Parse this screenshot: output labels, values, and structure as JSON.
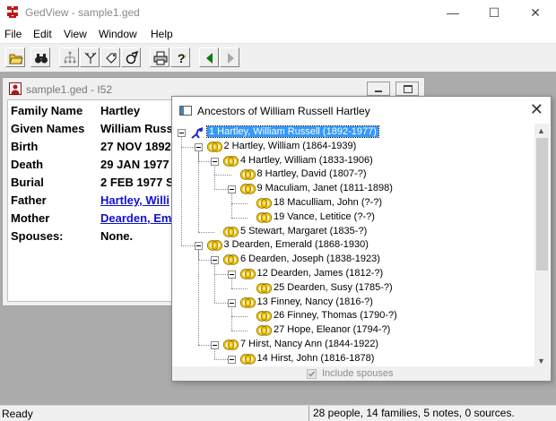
{
  "app": {
    "title": "GedView - sample1.ged",
    "minimize": "—",
    "maximize": "☐",
    "close": "✕"
  },
  "menu": [
    "File",
    "Edit",
    "View",
    "Window",
    "Help"
  ],
  "toolbar": {
    "buttons": [
      "open-folder",
      "binoculars-find",
      "family-tree",
      "descendant-tree",
      "tag",
      "gear-check",
      "print",
      "help-question",
      "back-arrow",
      "forward-arrow"
    ]
  },
  "individual": {
    "title": "sample1.ged - I52",
    "rows": [
      {
        "label": "Family Name",
        "value": "Hartley",
        "link": false
      },
      {
        "label": "Given Names",
        "value": "William Russ",
        "link": false
      },
      {
        "label": "Birth",
        "value": "27 NOV 1892",
        "link": false
      },
      {
        "label": "Death",
        "value": "29 JAN 1977 I",
        "link": false
      },
      {
        "label": "Burial",
        "value": "2 FEB 1977  S",
        "link": false
      },
      {
        "label": "Father",
        "value": "Hartley, Willi",
        "link": true
      },
      {
        "label": "Mother",
        "value": "Dearden, Em",
        "link": true
      },
      {
        "label": "Spouses:",
        "value": "None.",
        "link": false
      }
    ]
  },
  "ancestors": {
    "title": "Ancestors of William Russell Hartley",
    "close": "✕",
    "nodes": [
      {
        "text": "1  Hartley, William Russell (1892-1977)",
        "depth": 0,
        "expanded": true,
        "selected": true,
        "root": true
      },
      {
        "text": "2  Hartley, William (1864-1939)",
        "depth": 1,
        "expanded": true
      },
      {
        "text": "4  Hartley, William (1833-1906)",
        "depth": 2,
        "expanded": true
      },
      {
        "text": "8  Hartley, David (1807-?)",
        "depth": 3,
        "expanded": false
      },
      {
        "text": "9  Maculiam, Janet (1811-1898)",
        "depth": 3,
        "expanded": true
      },
      {
        "text": "18  Maculliam, John (?-?)",
        "depth": 4,
        "expanded": false
      },
      {
        "text": "19  Vance, Letitice (?-?)",
        "depth": 4,
        "expanded": false
      },
      {
        "text": "5  Stewart, Margaret (1835-?)",
        "depth": 2,
        "expanded": false
      },
      {
        "text": "3  Dearden, Emerald (1868-1930)",
        "depth": 1,
        "expanded": true
      },
      {
        "text": "6  Dearden, Joseph (1838-1923)",
        "depth": 2,
        "expanded": true
      },
      {
        "text": "12  Dearden, James (1812-?)",
        "depth": 3,
        "expanded": true
      },
      {
        "text": "25  Dearden, Susy (1785-?)",
        "depth": 4,
        "expanded": false
      },
      {
        "text": "13  Finney, Nancy (1816-?)",
        "depth": 3,
        "expanded": true
      },
      {
        "text": "26  Finney, Thomas (1790-?)",
        "depth": 4,
        "expanded": false
      },
      {
        "text": "27  Hope, Eleanor (1794-?)",
        "depth": 4,
        "expanded": false
      },
      {
        "text": "7  Hirst, Nancy Ann (1844-1922)",
        "depth": 2,
        "expanded": true
      },
      {
        "text": "14  Hirst, John (1816-1878)",
        "depth": 3,
        "expanded": true
      }
    ],
    "include_spouses": "Include spouses",
    "include_spouses_checked": true
  },
  "status": {
    "left": "Ready",
    "right": "28 people, 14 families, 5 notes, 0 sources."
  },
  "colors": {
    "selection": "#3399ff",
    "link": "#1111cc",
    "ring": "#f2c400",
    "mdi_background": "#ababab"
  }
}
